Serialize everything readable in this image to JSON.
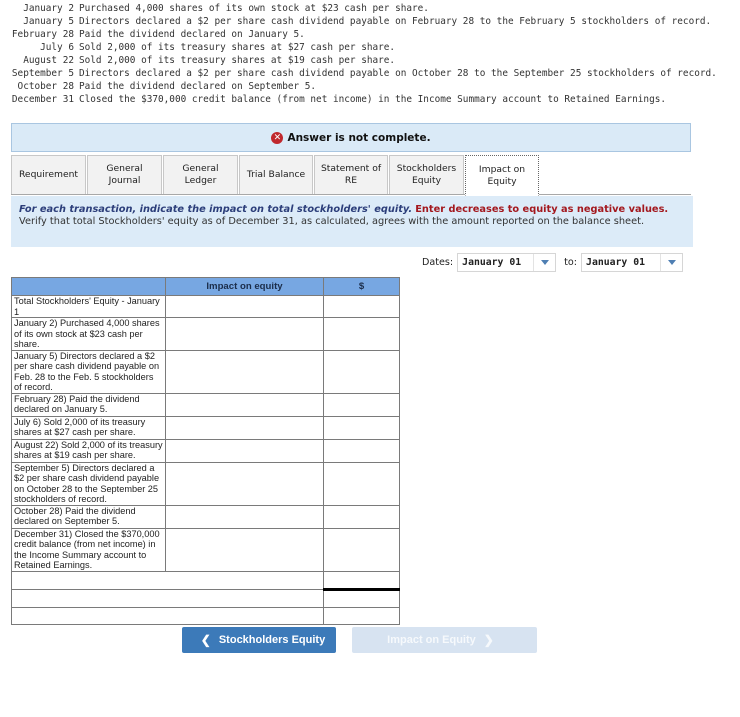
{
  "transactions": [
    {
      "date": "January 2",
      "text": "Purchased 4,000 shares of its own stock at $23 cash per share."
    },
    {
      "date": "January 5",
      "text": "Directors declared a $2 per share cash dividend payable on February 28 to the February 5 stockholders of record."
    },
    {
      "date": "February 28",
      "text": "Paid the dividend declared on January 5."
    },
    {
      "date": "July 6",
      "text": "Sold 2,000 of its treasury shares at $27 cash per share."
    },
    {
      "date": "August 22",
      "text": "Sold 2,000 of its treasury shares at $19 cash per share."
    },
    {
      "date": "September 5",
      "text": "Directors declared a $2 per share cash dividend payable on October 28 to the September 25 stockholders of record."
    },
    {
      "date": "October 28",
      "text": "Paid the dividend declared on September 5."
    },
    {
      "date": "December 31",
      "text": "Closed the $370,000 credit balance (from net income) in the Income Summary account to Retained Earnings."
    }
  ],
  "banner": {
    "icon": "error-x-icon",
    "text": "Answer is not complete.",
    "color": "#c0282d"
  },
  "tabs": [
    {
      "label": "Requirement",
      "active": false
    },
    {
      "label": "General Journal",
      "active": false
    },
    {
      "label": "General Ledger",
      "active": false
    },
    {
      "label": "Trial Balance",
      "active": false
    },
    {
      "label": "Statement of RE",
      "active": false
    },
    {
      "label": "Stockholders Equity",
      "active": false
    },
    {
      "label": "Impact on Equity",
      "active": true
    }
  ],
  "instructions": {
    "emphasis": "For each transaction, indicate the impact on total stockholders' equity.",
    "warning": "Enter decreases to equity as negative values.",
    "body": "Verify that total Stockholders' equity as of December 31, as calculated, agrees with the amount reported on the balance sheet."
  },
  "dates": {
    "label": "Dates:",
    "from_value": "January 01",
    "to_label": "to:",
    "to_value": "January 01"
  },
  "table": {
    "headers": [
      "",
      "Impact on equity",
      "$"
    ],
    "rows": [
      {
        "label": "Total Stockholders' Equity - January 1",
        "impact": "",
        "amount": ""
      },
      {
        "label": "January 2)  Purchased 4,000 shares of its own stock at $23 cash per share.",
        "impact": "",
        "amount": ""
      },
      {
        "label": "January 5)  Directors declared a $2 per share cash dividend payable on Feb. 28 to the Feb. 5 stockholders of record.",
        "impact": "",
        "amount": ""
      },
      {
        "label": "February 28)  Paid the dividend declared on January 5.",
        "impact": "",
        "amount": ""
      },
      {
        "label": "July 6)  Sold 2,000 of its treasury shares at $27 cash per share.",
        "impact": "",
        "amount": ""
      },
      {
        "label": "August 22)  Sold 2,000 of its treasury shares at $19 cash per share.",
        "impact": "",
        "amount": ""
      },
      {
        "label": "September 5)  Directors declared a $2 per share cash dividend payable on October 28 to the September 25 stockholders of record.",
        "impact": "",
        "amount": ""
      },
      {
        "label": "October 28)  Paid the dividend declared on September 5.",
        "impact": "",
        "amount": ""
      },
      {
        "label": "December 31)  Closed the $370,000 credit balance (from net income) in the Income Summary account to Retained Earnings.",
        "impact": "",
        "amount": ""
      }
    ],
    "footer_rows": [
      {
        "label": "",
        "amount": ""
      },
      {
        "label": "",
        "amount": ""
      },
      {
        "label": "",
        "amount": ""
      }
    ]
  },
  "navigation": {
    "prev_label": "Stockholders Equity",
    "next_label": "Impact on Equity",
    "prev_color": "#3c7ab9",
    "next_color": "#d7e3f1"
  }
}
